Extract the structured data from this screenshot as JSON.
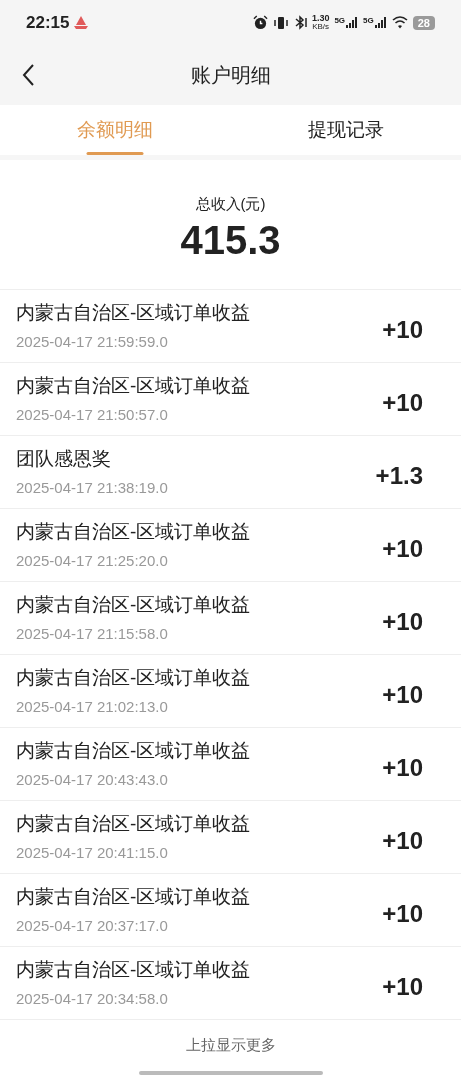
{
  "status_bar": {
    "time": "22:15",
    "speed_value": "1.30",
    "speed_unit": "KB/s",
    "networks": [
      "5G",
      "5G"
    ],
    "battery": "28"
  },
  "header": {
    "title": "账户明细"
  },
  "tabs": [
    {
      "label": "余额明细",
      "selected": true
    },
    {
      "label": "提现记录",
      "selected": false
    }
  ],
  "summary": {
    "label": "总收入(元)",
    "value": "415.3"
  },
  "records": [
    {
      "title": "内蒙古自治区-区域订单收益",
      "time": "2025-04-17 21:59:59.0",
      "amount": "+10"
    },
    {
      "title": "内蒙古自治区-区域订单收益",
      "time": "2025-04-17 21:50:57.0",
      "amount": "+10"
    },
    {
      "title": "团队感恩奖",
      "time": "2025-04-17 21:38:19.0",
      "amount": "+1.3"
    },
    {
      "title": "内蒙古自治区-区域订单收益",
      "time": "2025-04-17 21:25:20.0",
      "amount": "+10"
    },
    {
      "title": "内蒙古自治区-区域订单收益",
      "time": "2025-04-17 21:15:58.0",
      "amount": "+10"
    },
    {
      "title": "内蒙古自治区-区域订单收益",
      "time": "2025-04-17 21:02:13.0",
      "amount": "+10"
    },
    {
      "title": "内蒙古自治区-区域订单收益",
      "time": "2025-04-17 20:43:43.0",
      "amount": "+10"
    },
    {
      "title": "内蒙古自治区-区域订单收益",
      "time": "2025-04-17 20:41:15.0",
      "amount": "+10"
    },
    {
      "title": "内蒙古自治区-区域订单收益",
      "time": "2025-04-17 20:37:17.0",
      "amount": "+10"
    },
    {
      "title": "内蒙古自治区-区域订单收益",
      "time": "2025-04-17 20:34:58.0",
      "amount": "+10"
    }
  ],
  "footer": {
    "hint": "上拉显示更多"
  }
}
